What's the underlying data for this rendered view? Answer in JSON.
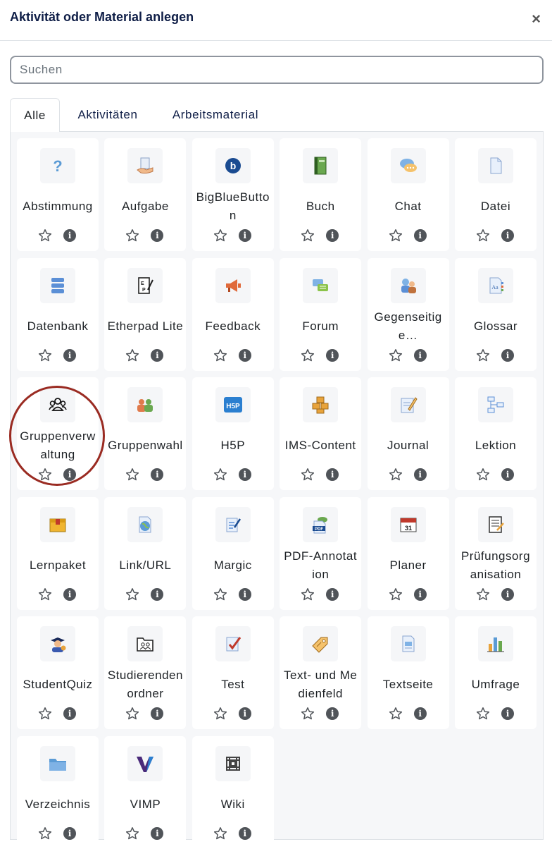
{
  "dialog": {
    "title": "Aktivität oder Material anlegen",
    "close_symbol": "×"
  },
  "search": {
    "placeholder": "Suchen"
  },
  "tabs": [
    {
      "label": "Alle",
      "active": true
    },
    {
      "label": "Aktivitäten",
      "active": false
    },
    {
      "label": "Arbeitsmaterial",
      "active": false
    }
  ],
  "info_symbol": "i",
  "modules": [
    {
      "label": "Abstimmung",
      "icon": "question-icon"
    },
    {
      "label": "Aufgabe",
      "icon": "assignment-hand-icon"
    },
    {
      "label": "BigBlueButton",
      "icon": "bigbluebutton-icon"
    },
    {
      "label": "Buch",
      "icon": "book-icon"
    },
    {
      "label": "Chat",
      "icon": "chat-bubbles-icon"
    },
    {
      "label": "Datei",
      "icon": "file-icon"
    },
    {
      "label": "Datenbank",
      "icon": "database-icon"
    },
    {
      "label": "Etherpad Lite",
      "icon": "etherpad-icon"
    },
    {
      "label": "Feedback",
      "icon": "megaphone-icon"
    },
    {
      "label": "Forum",
      "icon": "forum-icon"
    },
    {
      "label": "Gegenseitige…",
      "icon": "peer-review-icon"
    },
    {
      "label": "Glossar",
      "icon": "glossary-icon"
    },
    {
      "label": "Gruppenverwaltung",
      "icon": "group-people-icon"
    },
    {
      "label": "Gruppenwahl",
      "icon": "group-choice-icon"
    },
    {
      "label": "H5P",
      "icon": "h5p-icon"
    },
    {
      "label": "IMS-Content",
      "icon": "ims-boxes-icon"
    },
    {
      "label": "Journal",
      "icon": "journal-pencil-icon"
    },
    {
      "label": "Lektion",
      "icon": "lesson-flow-icon"
    },
    {
      "label": "Lernpaket",
      "icon": "package-icon"
    },
    {
      "label": "Link/URL",
      "icon": "globe-link-icon"
    },
    {
      "label": "Margic",
      "icon": "margic-icon"
    },
    {
      "label": "PDF-Annotation",
      "icon": "pdf-icon"
    },
    {
      "label": "Planer",
      "icon": "calendar-icon"
    },
    {
      "label": "Prüfungsorganisation",
      "icon": "exam-list-icon"
    },
    {
      "label": "StudentQuiz",
      "icon": "student-quiz-icon"
    },
    {
      "label": "Studierendenordner",
      "icon": "student-folder-icon"
    },
    {
      "label": "Test",
      "icon": "test-check-icon"
    },
    {
      "label": "Text- und Medienfeld",
      "icon": "label-tag-icon"
    },
    {
      "label": "Textseite",
      "icon": "text-page-icon"
    },
    {
      "label": "Umfrage",
      "icon": "bar-chart-icon"
    },
    {
      "label": "Verzeichnis",
      "icon": "folder-icon"
    },
    {
      "label": "VIMP",
      "icon": "vimp-icon"
    },
    {
      "label": "Wiki",
      "icon": "wiki-icon"
    }
  ],
  "bigbluebutton_letter": "b",
  "h5p_text": "H5P",
  "pdf_text": "PDF",
  "calendar_day": "31",
  "glossary_text": "Aa"
}
